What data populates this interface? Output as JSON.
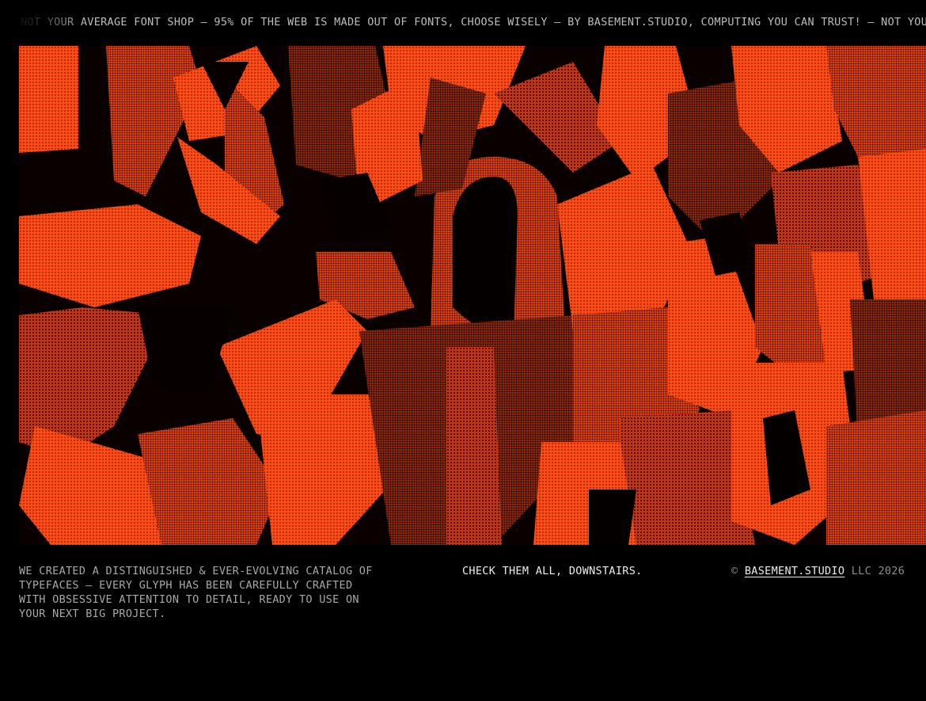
{
  "marquee": {
    "text": "NOT YOUR AVERAGE FONT SHOP — 95% OF THE WEB IS MADE OUT OF FONTS, CHOOSE WISELY — BY BASEMENT.STUDIO, COMPUTING YOU CAN TRUST! — NOT YOUR AVERAGE FONT SHOP"
  },
  "hero": {
    "accent_color": "#ff4a12",
    "dark_color": "#0a0200"
  },
  "footer": {
    "about": "WE CREATED A DISTINGUISHED & EVER-EVOLVING CATALOG OF TYPEFACES — EVERY GLYPH HAS BEEN CAREFULLY CRAFTED WITH OBSESSIVE ATTENTION TO DETAIL, READY TO USE ON YOUR NEXT BIG PROJECT.",
    "cta": "CHECK THEM ALL, DOWNSTAIRS.",
    "copyright_symbol": "©",
    "studio_link": "BASEMENT.STUDIO",
    "copyright_suffix": "LLC 2026"
  }
}
